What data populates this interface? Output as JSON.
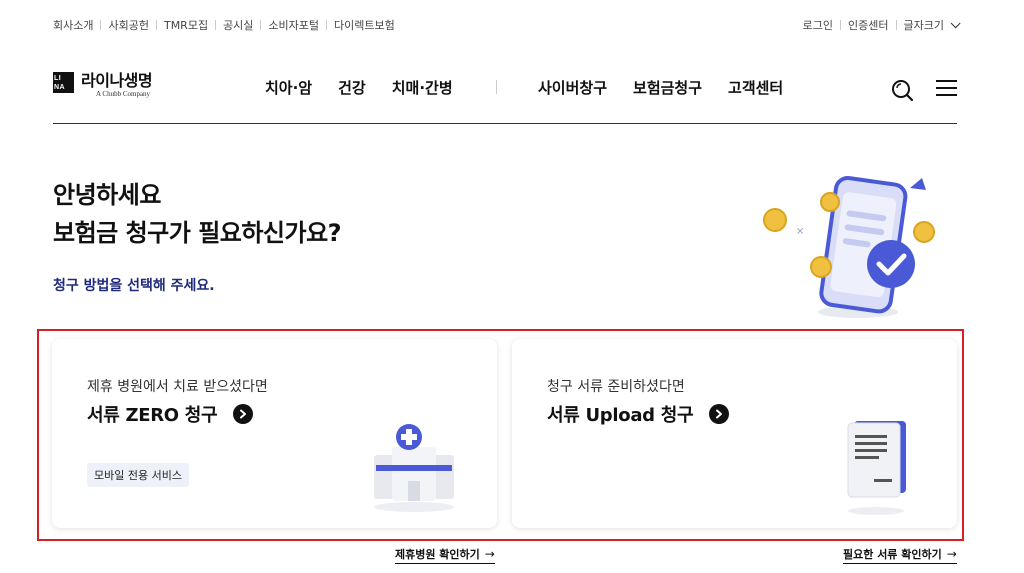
{
  "utility": {
    "left": [
      "회사소개",
      "사회공헌",
      "TMR모집",
      "공시실",
      "소비자포털",
      "다이렉트보험"
    ],
    "right": [
      "로그인",
      "인증센터",
      "글자크기"
    ]
  },
  "logo": {
    "name": "라이나생명",
    "sub": "A Chubb Company",
    "mark": [
      "LI",
      "NA"
    ]
  },
  "nav": {
    "group_a": [
      "치아·암",
      "건강",
      "치매·간병"
    ],
    "group_b": [
      "사이버창구",
      "보험금청구",
      "고객센터"
    ]
  },
  "hero": {
    "line1": "안녕하세요",
    "line2": "보험금 청구가 필요하신가요?",
    "sub": "청구 방법을 선택해 주세요."
  },
  "cards": [
    {
      "pre": "제휴 병원에서 치료 받으셨다면",
      "title": "서류 ZERO 청구",
      "badge": "모바일 전용 서비스",
      "link": "제휴병원 확인하기"
    },
    {
      "pre": "청구 서류 준비하셨다면",
      "title": "서류 Upload 청구",
      "link": "필요한 서류 확인하기"
    }
  ],
  "icons": {
    "search": "search-icon",
    "menu": "hamburger-menu-icon",
    "chevron": "chevron-down-icon",
    "arrow": "arrow-right-icon"
  },
  "colors": {
    "accent_navy": "#1e2a7a",
    "highlight_red": "#d42020",
    "illustration_blue": "#4a5ad6",
    "coin_gold": "#f0c040"
  }
}
